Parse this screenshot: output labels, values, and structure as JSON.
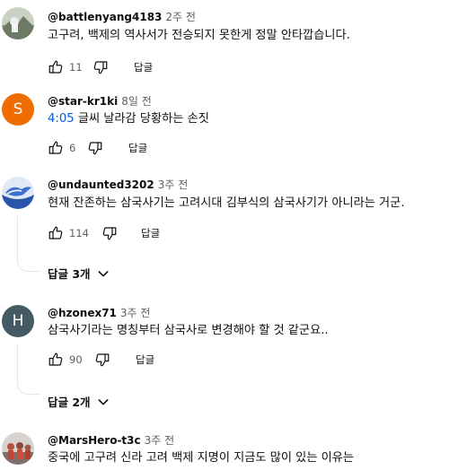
{
  "comments": [
    {
      "handle": "@battlenyang4183",
      "time": "2주 전",
      "text": "고구려, 백제의 역사서가 전승되지 못한게 정말 안타깝습니다.",
      "likes": "11",
      "reply_label": "답글",
      "avatar": {
        "type": "photo",
        "icon": "landscape-photo-avatar"
      }
    },
    {
      "handle": "@star-kr1ki",
      "time": "8일 전",
      "timestamp_link": "4:05",
      "text": " 글씨 날라감 당황하는 손짓",
      "likes": "6",
      "reply_label": "답글",
      "avatar": {
        "type": "letter",
        "letter": "S",
        "color": "#ef6c00"
      }
    },
    {
      "handle": "@undaunted3202",
      "time": "3주 전",
      "text": "현재 잔존하는 삼국사기는  고려시대 김부식의 삼국사기가 아니라는 거군.",
      "likes": "114",
      "reply_label": "답글",
      "replies_label": "답글 3개",
      "avatar": {
        "type": "photo",
        "icon": "bird-photo-avatar"
      }
    },
    {
      "handle": "@hzonex71",
      "time": "3주 전",
      "text": "삼국사기라는 명칭부터 삼국사로 변경해야 할 것 같군요..",
      "likes": "90",
      "reply_label": "답글",
      "replies_label": "답글 2개",
      "avatar": {
        "type": "letter",
        "letter": "H",
        "color": "#455a64"
      }
    },
    {
      "handle": "@MarsHero-t3c",
      "time": "3주 전",
      "text": "중국에 고구려 신라 고려 백제 지명이 지금도 많이 있는 이유는",
      "avatar": {
        "type": "photo",
        "icon": "people-photo-avatar"
      }
    }
  ],
  "icons": {
    "like": "thumb-up-icon",
    "dislike": "thumb-down-icon",
    "expand": "chevron-down-icon"
  }
}
